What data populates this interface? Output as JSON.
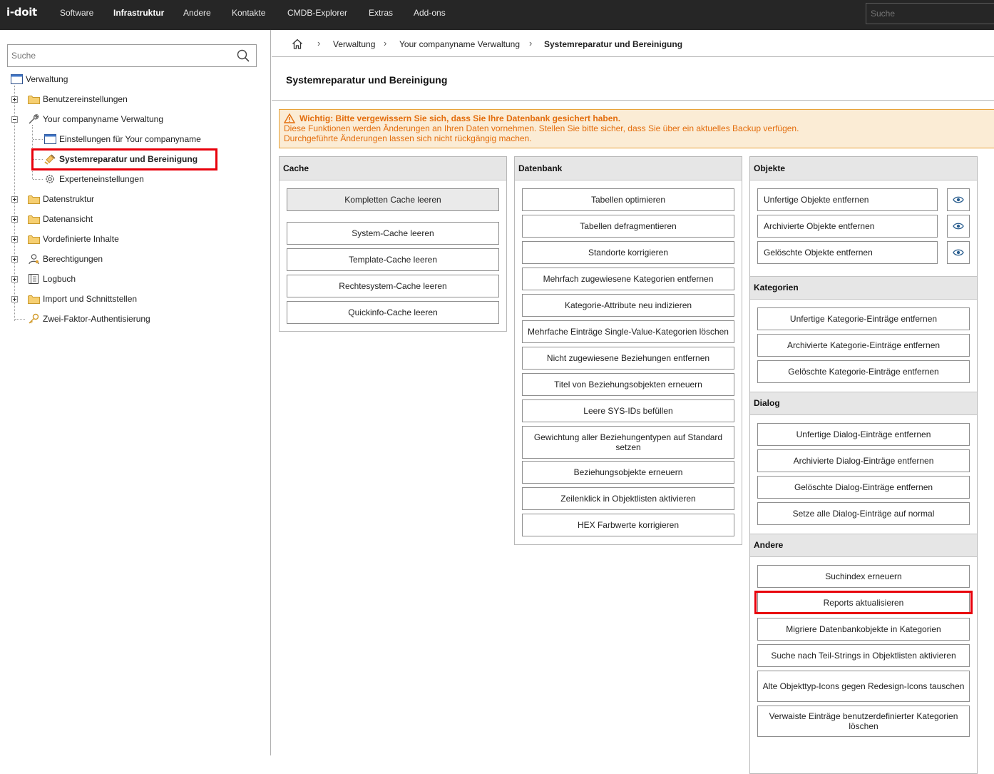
{
  "topbar": {
    "logo": "i-doit",
    "nav": [
      "Software",
      "Infrastruktur",
      "Andere",
      "Kontakte",
      "CMDB-Explorer",
      "Extras",
      "Add-ons"
    ],
    "active_nav": "Infrastruktur",
    "search_placeholder": "Suche"
  },
  "sidebar": {
    "search_placeholder": "Suche",
    "root": "Verwaltung",
    "items": {
      "benutzer": "Benutzereinstellungen",
      "company": "Your companyname Verwaltung",
      "einstellungen": "Einstellungen für Your companyname",
      "systemreparatur": "Systemreparatur und Bereinigung",
      "experten": "Experteneinstellungen",
      "datenstruktur": "Datenstruktur",
      "datenansicht": "Datenansicht",
      "vordefiniert": "Vordefinierte Inhalte",
      "berechtigungen": "Berechtigungen",
      "logbuch": "Logbuch",
      "import": "Import und Schnittstellen",
      "zweifaktor": "Zwei-Faktor-Authentisierung"
    }
  },
  "breadcrumb": {
    "items": [
      "Verwaltung",
      "Your companyname Verwaltung",
      "Systemreparatur und Bereinigung"
    ]
  },
  "page_title": "Systemreparatur und Bereinigung",
  "warning": {
    "title": "Wichtig: Bitte vergewissern Sie sich, dass Sie Ihre Datenbank gesichert haben.",
    "line1": "Diese Funktionen werden Änderungen an Ihren Daten vornehmen. Stellen Sie bitte sicher, dass Sie über ein aktuelles Backup verfügen.",
    "line2": "Durchgeführte Änderungen lassen sich nicht rückgängig machen."
  },
  "cache": {
    "title": "Cache",
    "buttons": [
      "Kompletten Cache leeren",
      "System-Cache leeren",
      "Template-Cache leeren",
      "Rechtesystem-Cache leeren",
      "Quickinfo-Cache leeren"
    ]
  },
  "datenbank": {
    "title": "Datenbank",
    "buttons": [
      "Tabellen optimieren",
      "Tabellen defragmentieren",
      "Standorte korrigieren",
      "Mehrfach zugewiesene Kategorien entfernen",
      "Kategorie-Attribute neu indizieren",
      "Mehrfache Einträge Single-Value-Kategorien löschen",
      "Nicht zugewiesene Beziehungen entfernen",
      "Titel von Beziehungsobjekten erneuern",
      "Leere SYS-IDs befüllen",
      "Gewichtung aller Beziehungentypen auf Standard setzen",
      "Beziehungsobjekte erneuern",
      "Zeilenklick in Objektlisten aktivieren",
      "HEX Farbwerte korrigieren"
    ]
  },
  "objekte": {
    "title": "Objekte",
    "buttons": [
      "Unfertige Objekte entfernen",
      "Archivierte Objekte entfernen",
      "Gelöschte Objekte entfernen"
    ]
  },
  "kategorien": {
    "title": "Kategorien",
    "buttons": [
      "Unfertige Kategorie-Einträge entfernen",
      "Archivierte Kategorie-Einträge entfernen",
      "Gelöschte Kategorie-Einträge entfernen"
    ]
  },
  "dialog": {
    "title": "Dialog",
    "buttons": [
      "Unfertige Dialog-Einträge entfernen",
      "Archivierte Dialog-Einträge entfernen",
      "Gelöschte Dialog-Einträge entfernen",
      "Setze alle Dialog-Einträge auf normal"
    ]
  },
  "andere": {
    "title": "Andere",
    "buttons": [
      "Suchindex erneuern",
      "Reports aktualisieren",
      "Migriere Datenbankobjekte in Kategorien",
      "Suche nach Teil-Strings in Objektlisten aktivieren",
      "Alte Objekttyp-Icons gegen Redesign-Icons tauschen",
      "Verwaiste Einträge benutzerdefinierter Kategorien löschen"
    ]
  },
  "colors": {
    "topbar": "#262626",
    "highlight": "#e8000b",
    "warning_text": "#e36d0c",
    "warning_bg": "#fbecd5",
    "panel_header": "#e6e6e6"
  }
}
